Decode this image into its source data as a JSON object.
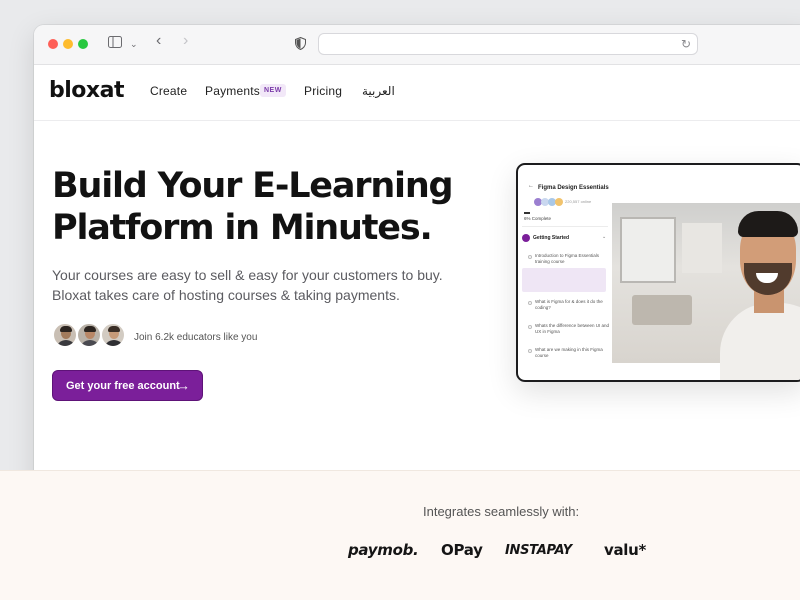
{
  "browser": {
    "icons": [
      "sidebar-icon",
      "chevron-down-icon",
      "back-icon",
      "forward-icon",
      "shield-icon",
      "reload-icon"
    ]
  },
  "nav": {
    "logo": "bloxat",
    "links": [
      {
        "label": "Create"
      },
      {
        "label": "Payments",
        "badge": "NEW"
      },
      {
        "label": "Pricing"
      },
      {
        "label": "العربية"
      }
    ]
  },
  "hero": {
    "title_line1": "Build Your E-Learning",
    "title_line2": "Platform in Minutes.",
    "subtitle_line1": "Your courses are easy to sell & easy for your customers to buy.",
    "subtitle_line2": "Bloxat takes care of hosting courses & taking payments.",
    "join_text": "Join 6.2k educators like you",
    "cta_label": "Get your free account",
    "cta_icon": "arrow-right-icon",
    "accent_color": "#7b1f9a"
  },
  "preview": {
    "course_title": "Figma Design Essentials",
    "online_text": "220,557 online",
    "progress_text": "6% Complete",
    "progress": 0.06,
    "section_title": "Getting Started",
    "lessons": [
      "Introduction to Figma Essentials training course",
      "What is Figma for & does it do the coding?",
      "Whats the difference between UI and UX in Figma",
      "What are we making in this Figma course"
    ]
  },
  "integrations": {
    "heading": "Integrates seamlessly with:",
    "partners": [
      "paymob.",
      "OPay",
      "INSTAPAY",
      "valu*"
    ]
  }
}
